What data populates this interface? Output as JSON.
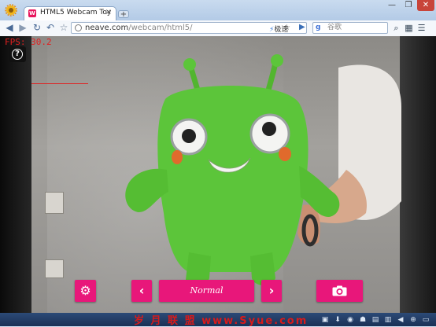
{
  "browser": {
    "tab_title": "HTML5 Webcam Toy",
    "tab_favicon_letter": "W",
    "new_tab_label": "+",
    "tab_close_label": "×",
    "window_controls": [
      "—",
      "❐",
      "✕"
    ],
    "url_prefix": "neave.com",
    "url_path": "/webcam/html5/",
    "speed_label": "极速",
    "search_engine_logo": "g",
    "search_placeholder": "谷歌"
  },
  "overlay": {
    "fps_text": "FPS:  30.2",
    "help_label": "?"
  },
  "controls": {
    "settings_icon": "gear-icon",
    "prev_label": "‹",
    "filter_name": "Normal",
    "next_label": "›",
    "camera_icon": "camera-icon"
  },
  "taskbar": {
    "watermark_text": "岁 月 联 盟  www.Syue.com"
  },
  "colors": {
    "accent": "#e8177a",
    "fps_red": "#e02020",
    "toy_green": "#5cc53a"
  }
}
